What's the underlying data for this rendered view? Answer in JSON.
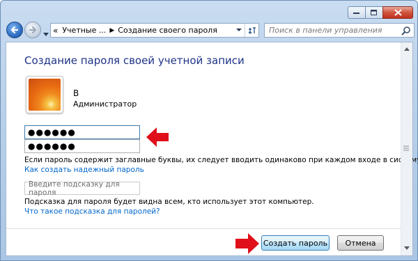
{
  "window": {
    "caption_buttons": [
      "minimize-icon",
      "maximize-icon",
      "close-icon"
    ]
  },
  "nav": {
    "back_icon": "back-arrow-icon",
    "forward_icon": "forward-arrow-icon",
    "address": {
      "crumbs": [
        "«",
        "Учетные ...",
        "Создание своего пароля"
      ]
    },
    "search_placeholder": "Поиск в панели управления"
  },
  "page": {
    "title": "Создание пароля своей учетной записи",
    "user": {
      "name": "В",
      "role": "Администратор"
    },
    "password_value": "●●●●●●",
    "confirm_value": "●●●●●●",
    "note_caps": "Если пароль содержит заглавные буквы, их следует вводить одинаково при каждом входе в систему.",
    "link_strong": "Как создать надежный пароль",
    "hint_placeholder": "Введите подсказку для пароля",
    "hint_note": "Подсказка для пароля будет видна всем, кто использует этот компьютер.",
    "link_hint": "Что такое подсказка для паролей?",
    "create_button": "Создать пароль",
    "cancel_button": "Отмена"
  },
  "colors": {
    "title": "#1e3287",
    "link": "#0066cc",
    "annotation_arrow": "#e0101a"
  }
}
